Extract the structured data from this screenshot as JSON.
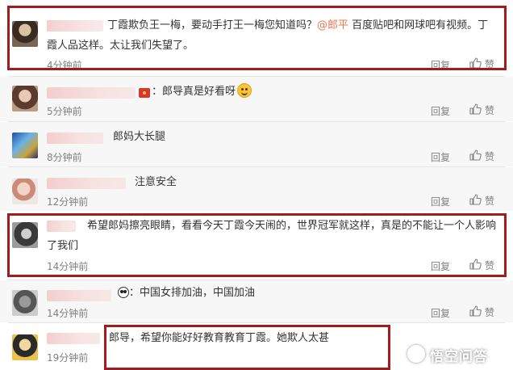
{
  "comments": [
    {
      "text_before": "丁霞欺负王一梅，要动手打王一梅您知道吗？",
      "mention": "@郎平",
      "text_after": "百度贴吧和网球吧有视频。丁",
      "text_line2": "霞人品这样。太让我们失望了。",
      "time": "4分钟前"
    },
    {
      "text": "：郎导真是好看呀",
      "time": "5分钟前"
    },
    {
      "text": "郎妈大长腿",
      "time": "8分钟前"
    },
    {
      "text": "注意安全",
      "time": "12分钟前"
    },
    {
      "text": "希望郎妈擦亮眼睛，看看今天丁霞今天闹的，世界冠军就这样，真是的不能让一个人影响",
      "text_line2": "了我们",
      "time": "14分钟前"
    },
    {
      "text": "：中国女排加油，中国加油",
      "time": "14分钟前"
    },
    {
      "text": "郎导，希望你能好好教育教育丁霞。她欺人太甚",
      "time": "19分钟前"
    }
  ],
  "actions": {
    "reply": "回复",
    "like": "赞"
  },
  "watermark": {
    "text": "悟空问答",
    "icon": "wukong-logo-icon"
  },
  "icons": {
    "like": "thumbs-up-icon",
    "emoji": "smiley-emoji-icon",
    "red_envelope": "red-envelope-icon",
    "panda": "panda-icon"
  },
  "colors": {
    "highlight_border": "#a01d1d",
    "mention": "#eb7350",
    "meta_text": "#808080",
    "alt_row_background": "#f7f7f7"
  }
}
